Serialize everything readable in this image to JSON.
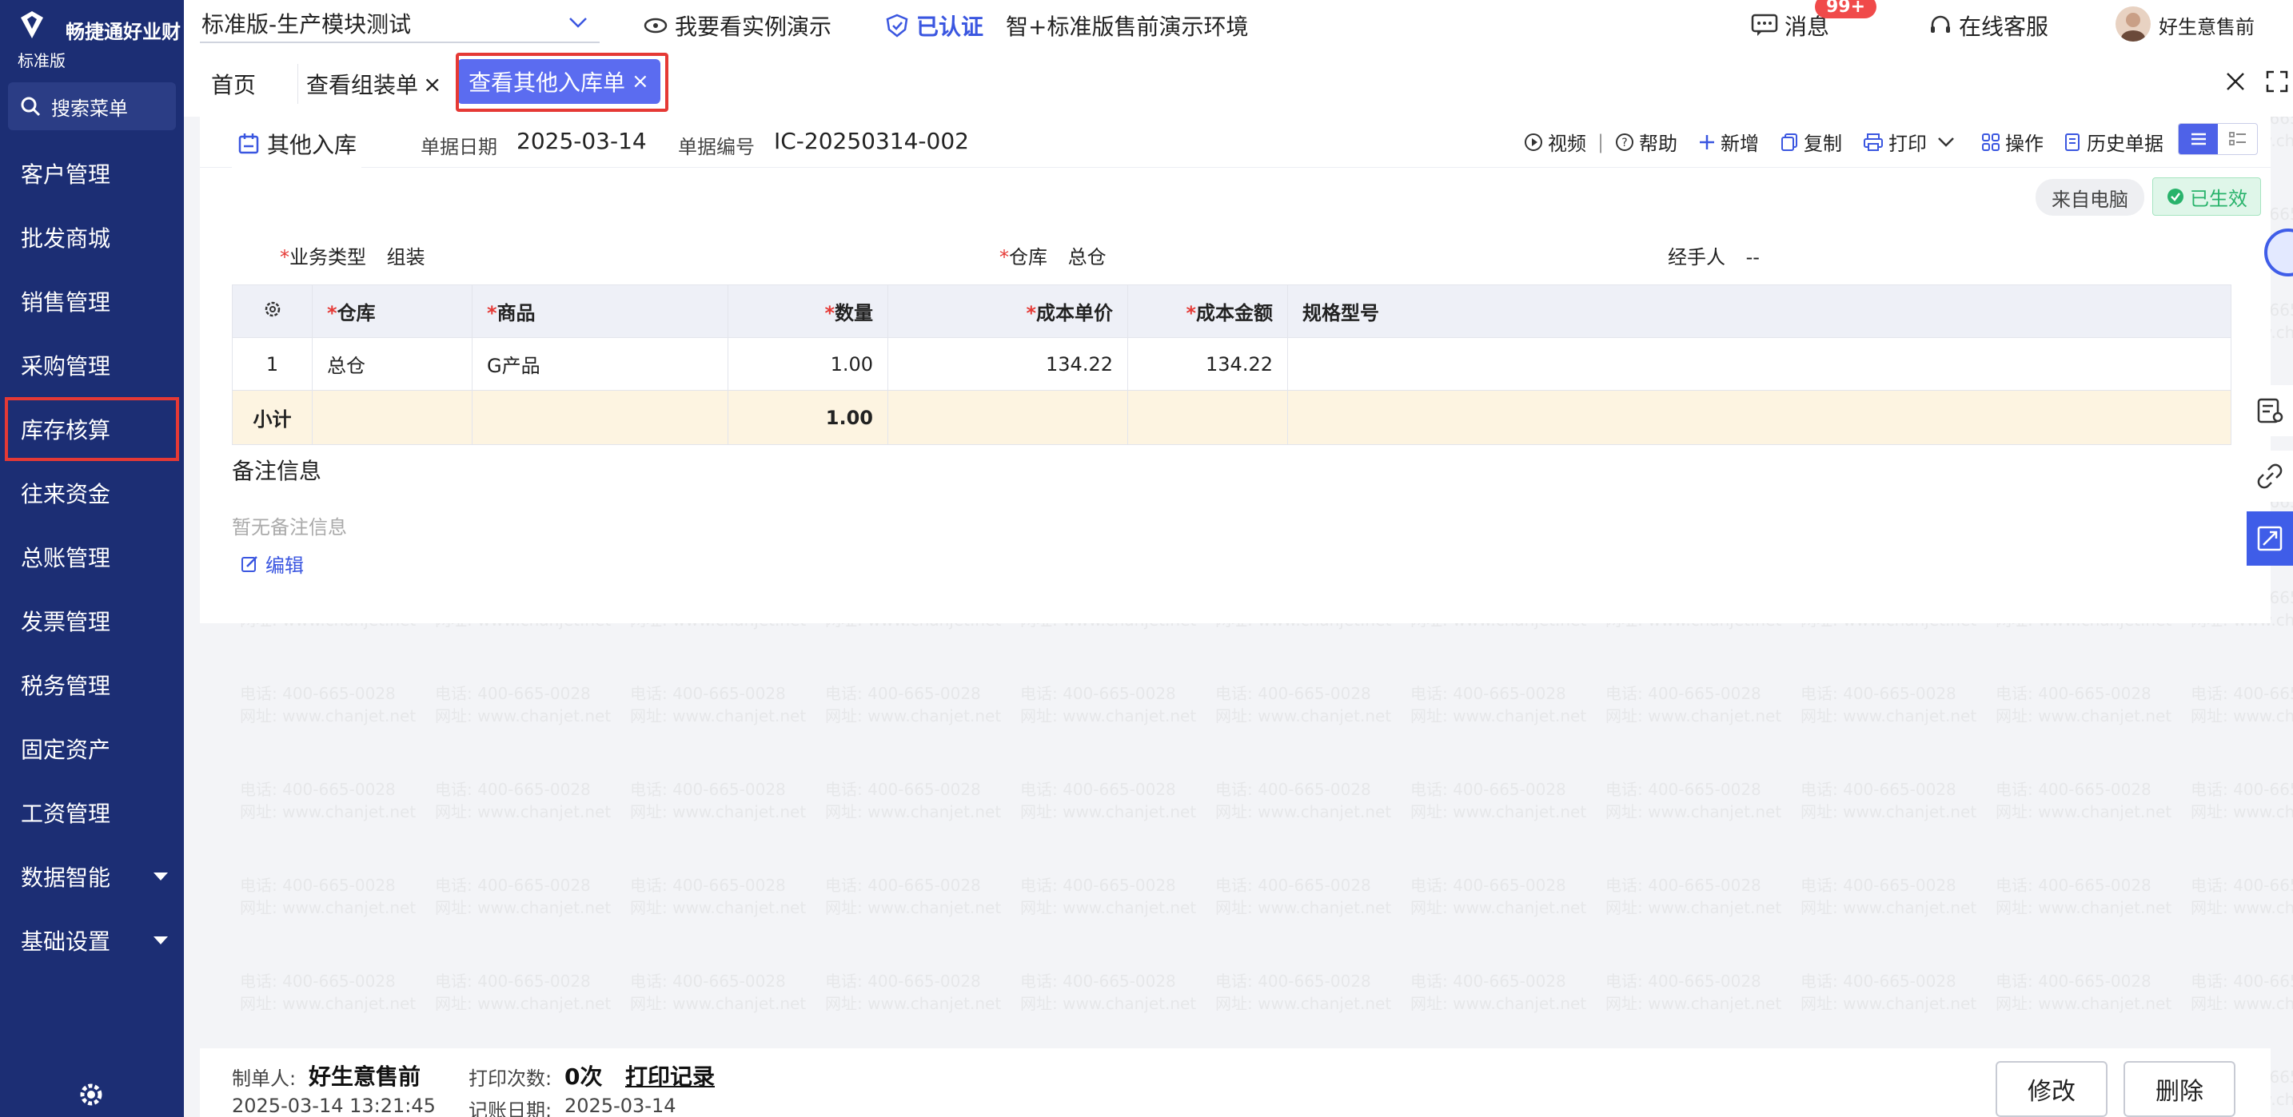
{
  "brand": {
    "name": "畅捷通好业财",
    "edition": "标准版"
  },
  "sidebar": {
    "search_label": "搜索菜单",
    "items": [
      {
        "label": "客户管理"
      },
      {
        "label": "批发商城"
      },
      {
        "label": "销售管理"
      },
      {
        "label": "采购管理"
      },
      {
        "label": "库存核算"
      },
      {
        "label": "往来资金"
      },
      {
        "label": "总账管理"
      },
      {
        "label": "发票管理"
      },
      {
        "label": "税务管理"
      },
      {
        "label": "固定资产"
      },
      {
        "label": "工资管理"
      },
      {
        "label": "数据智能"
      },
      {
        "label": "基础设置"
      }
    ]
  },
  "topbar": {
    "account": "标准版-生产模块测试",
    "demo_link": "我要看实例演示",
    "verified": "已认证",
    "env": "智+标准版售前演示环境",
    "messages": "消息",
    "messages_badge": "99+",
    "support": "在线客服",
    "user": "好生意售前"
  },
  "tabs": [
    {
      "label": "首页"
    },
    {
      "label": "查看组装单"
    },
    {
      "label": "查看其他入库单"
    }
  ],
  "doc": {
    "title": "其他入库",
    "date_label": "单据日期",
    "date": "2025-03-14",
    "no_label": "单据编号",
    "no": "IC-20250314-002",
    "tools": {
      "video": "视频",
      "help": "帮助",
      "add": "新增",
      "copy": "复制",
      "print": "打印",
      "ops": "操作",
      "history": "历史单据"
    },
    "source_tag": "来自电脑",
    "status_tag": "已生效",
    "fields": {
      "biz_type_label": "业务类型",
      "biz_type": "组装",
      "warehouse_label": "仓库",
      "warehouse": "总仓",
      "handler_label": "经手人",
      "handler": "--"
    }
  },
  "table": {
    "headers": [
      "仓库",
      "商品",
      "数量",
      "成本单价",
      "成本金额",
      "规格型号"
    ],
    "rows": [
      {
        "idx": "1",
        "warehouse": "总仓",
        "product": "G产品",
        "qty": "1.00",
        "unit_cost": "134.22",
        "amount": "134.22",
        "spec": ""
      }
    ],
    "subtotal_label": "小计",
    "subtotal_qty": "1.00"
  },
  "notes": {
    "title": "备注信息",
    "empty": "暂无备注信息",
    "edit": "编辑"
  },
  "footer": {
    "maker_label": "制单人:",
    "maker": "好生意售前",
    "created_at": "2025-03-14 13:21:45",
    "print_count_label": "打印次数:",
    "print_count": "0次",
    "print_log": "打印记录",
    "post_date_label": "记账日期:",
    "post_date": "2025-03-14",
    "edit_btn": "修改",
    "delete_btn": "删除"
  },
  "watermark": {
    "line1": "电话: 400-665-0028",
    "line2": "网址: www.chanjet.net"
  },
  "colors": {
    "sidebar": "#1c2e74",
    "accent": "#5b6cf0",
    "highlight": "#e53935",
    "success": "#28b36b"
  }
}
